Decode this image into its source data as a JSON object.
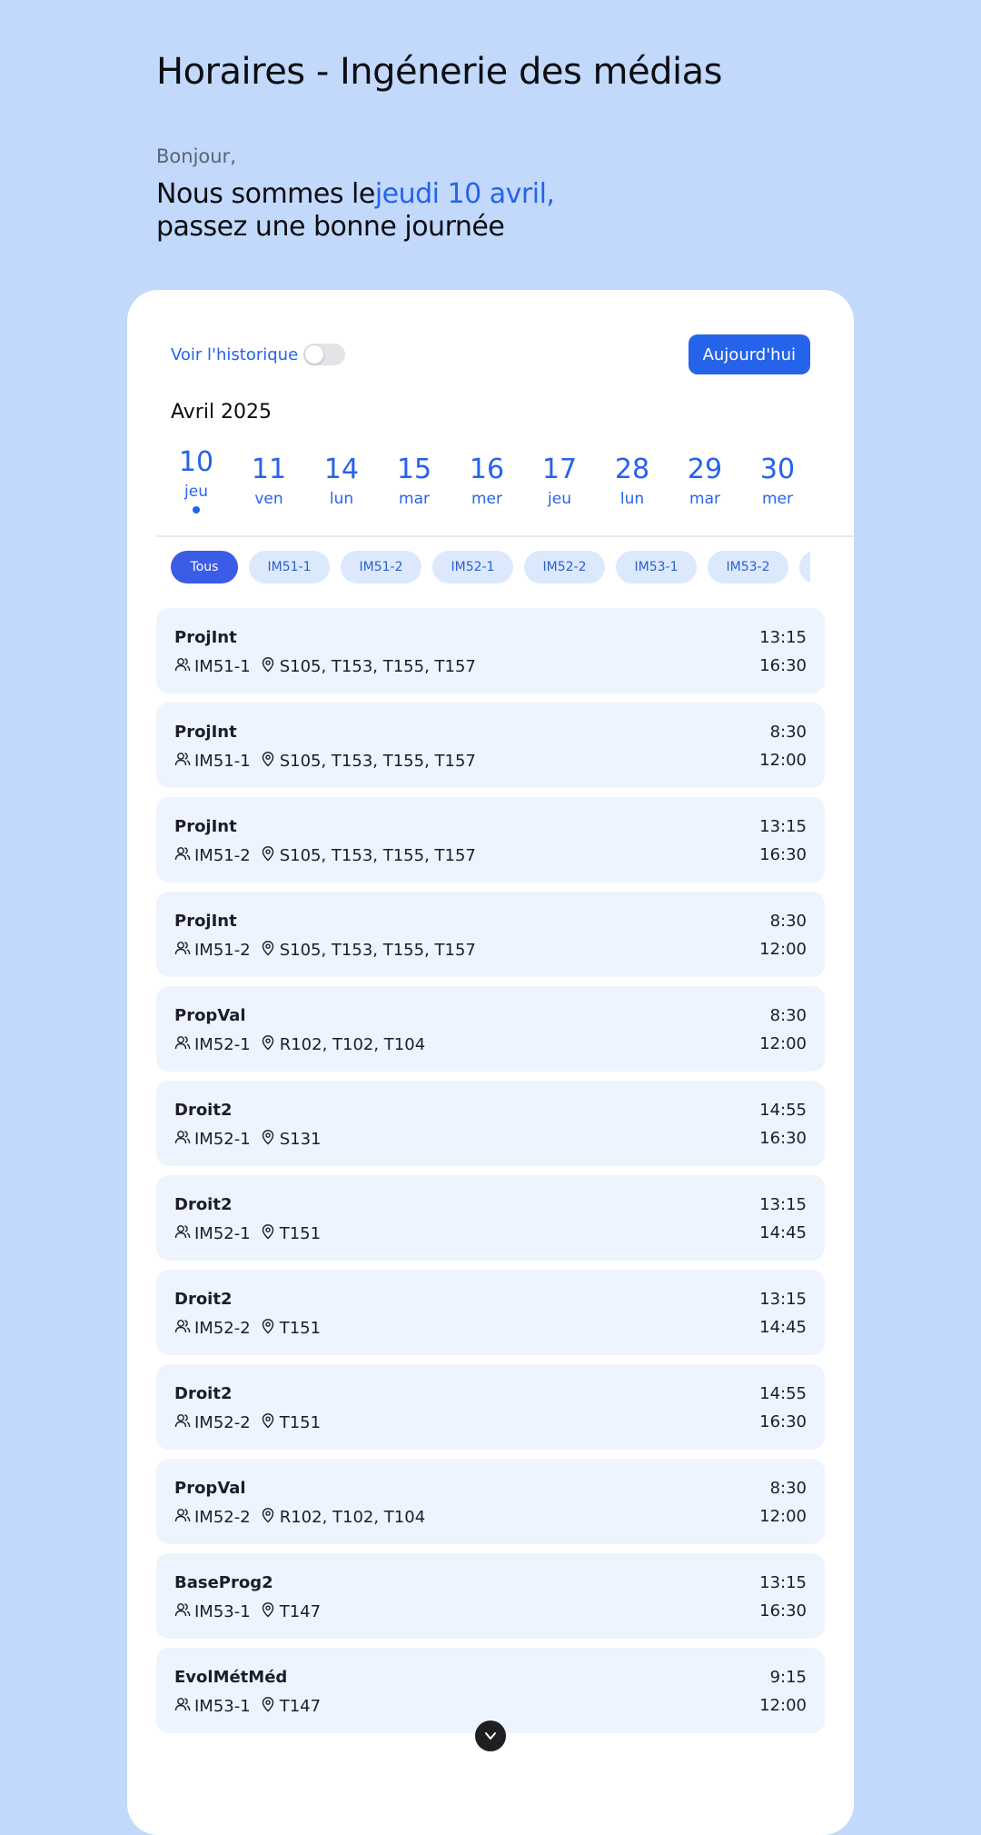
{
  "header": {
    "title": "Horaires - Ingénerie des médias",
    "greeting": "Bonjour,",
    "date_prefix": "Nous sommes le",
    "date_highlight": "jeudi 10 avril,",
    "date_suffix": "passez une bonne journée"
  },
  "controls": {
    "history_label": "Voir l'historique",
    "history_enabled": false,
    "today_button": "Aujourd'hui",
    "month_label": "Avril 2025"
  },
  "days": [
    {
      "num": "10",
      "dow": "jeu",
      "active": true
    },
    {
      "num": "11",
      "dow": "ven"
    },
    {
      "num": "14",
      "dow": "lun"
    },
    {
      "num": "15",
      "dow": "mar"
    },
    {
      "num": "16",
      "dow": "mer"
    },
    {
      "num": "17",
      "dow": "jeu"
    },
    {
      "num": "28",
      "dow": "lun"
    },
    {
      "num": "29",
      "dow": "mar"
    },
    {
      "num": "30",
      "dow": "mer"
    }
  ],
  "filters": [
    {
      "label": "Tous",
      "active": true
    },
    {
      "label": "IM51-1"
    },
    {
      "label": "IM51-2"
    },
    {
      "label": "IM52-1"
    },
    {
      "label": "IM52-2"
    },
    {
      "label": "IM53-1"
    },
    {
      "label": "IM53-2"
    },
    {
      "label": ""
    }
  ],
  "events": [
    {
      "name": "ProjInt",
      "group": "IM51-1",
      "rooms": "S105, T153, T155, T157",
      "start": "13:15",
      "end": "16:30"
    },
    {
      "name": "ProjInt",
      "group": "IM51-1",
      "rooms": "S105, T153, T155, T157",
      "start": "8:30",
      "end": "12:00"
    },
    {
      "name": "ProjInt",
      "group": "IM51-2",
      "rooms": "S105, T153, T155, T157",
      "start": "13:15",
      "end": "16:30"
    },
    {
      "name": "ProjInt",
      "group": "IM51-2",
      "rooms": "S105, T153, T155, T157",
      "start": "8:30",
      "end": "12:00"
    },
    {
      "name": "PropVal",
      "group": "IM52-1",
      "rooms": "R102, T102, T104",
      "start": "8:30",
      "end": "12:00"
    },
    {
      "name": "Droit2",
      "group": "IM52-1",
      "rooms": "S131",
      "start": "14:55",
      "end": "16:30"
    },
    {
      "name": "Droit2",
      "group": "IM52-1",
      "rooms": "T151",
      "start": "13:15",
      "end": "14:45"
    },
    {
      "name": "Droit2",
      "group": "IM52-2",
      "rooms": "T151",
      "start": "13:15",
      "end": "14:45"
    },
    {
      "name": "Droit2",
      "group": "IM52-2",
      "rooms": "T151",
      "start": "14:55",
      "end": "16:30"
    },
    {
      "name": "PropVal",
      "group": "IM52-2",
      "rooms": "R102, T102, T104",
      "start": "8:30",
      "end": "12:00"
    },
    {
      "name": "BaseProg2",
      "group": "IM53-1",
      "rooms": "T147",
      "start": "13:15",
      "end": "16:30"
    },
    {
      "name": "EvolMétMéd",
      "group": "IM53-1",
      "rooms": "T147",
      "start": "9:15",
      "end": "12:00"
    }
  ],
  "icons": {
    "group": "user-group-icon",
    "room": "map-pin-icon",
    "fab": "chevron-down-icon"
  },
  "colors": {
    "background": "#c2d9fb",
    "accent": "#2563eb",
    "event_bg": "#edf4fe",
    "chip_active": "#3b5ce6"
  }
}
